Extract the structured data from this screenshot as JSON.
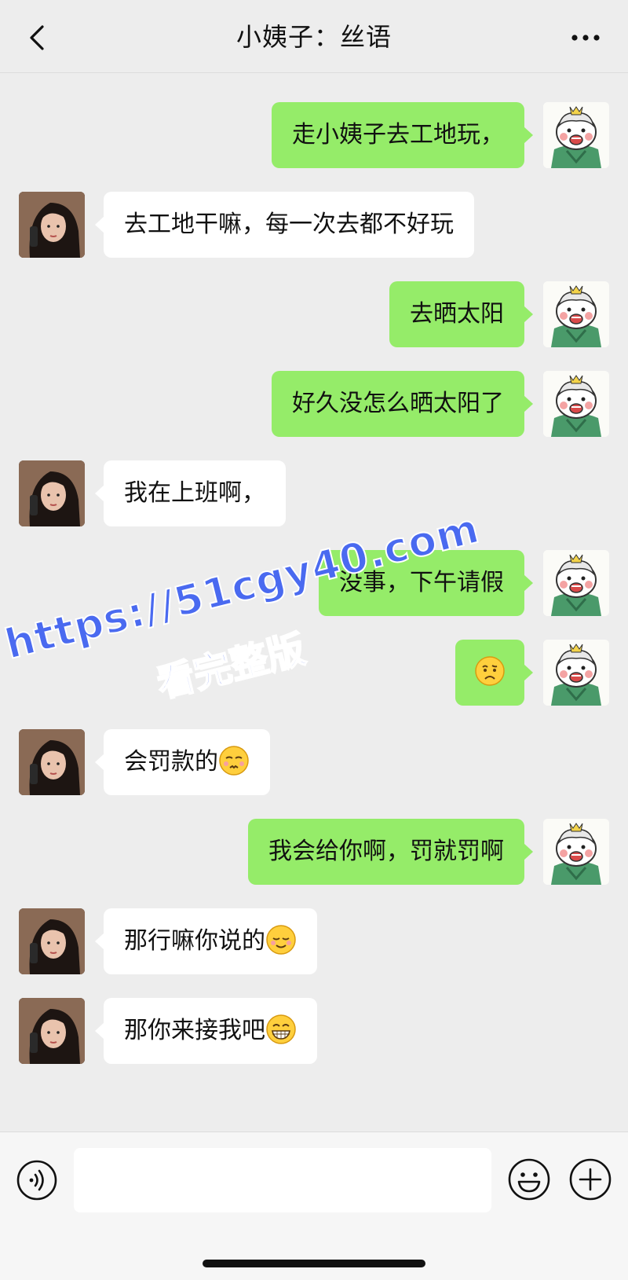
{
  "header": {
    "title": "小姨子：丝语",
    "back_icon": "chevron-left-icon",
    "more_icon": "ellipsis-icon"
  },
  "messages": [
    {
      "sender": "me",
      "text": "走小姨子去工地玩，"
    },
    {
      "sender": "them",
      "text": "去工地干嘛，每一次去都不好玩"
    },
    {
      "sender": "me",
      "text": "去晒太阳"
    },
    {
      "sender": "me",
      "text": "好久没怎么晒太阳了"
    },
    {
      "sender": "them",
      "text": "我在上班啊，"
    },
    {
      "sender": "me",
      "text": "没事，下午请假"
    },
    {
      "sender": "me",
      "text": "",
      "emoji": "confused-face-emoji"
    },
    {
      "sender": "them",
      "text": "会罚款的",
      "emoji": "shush-face-emoji"
    },
    {
      "sender": "me",
      "text": "我会给你啊，罚就罚啊"
    },
    {
      "sender": "them",
      "text": "那行嘛你说的",
      "emoji": "sly-smile-emoji"
    },
    {
      "sender": "them",
      "text": "那你来接我吧",
      "emoji": "grin-emoji"
    }
  ],
  "watermark": {
    "line1": "https://51cgy40.com",
    "line2": "看完整版"
  },
  "input_bar": {
    "voice_icon": "voice-icon",
    "emoji_icon": "smiley-icon",
    "plus_icon": "plus-icon"
  },
  "colors": {
    "me_bubble": "#95ec69",
    "them_bubble": "#ffffff",
    "background": "#ededed",
    "watermark": "#4a6af0"
  }
}
